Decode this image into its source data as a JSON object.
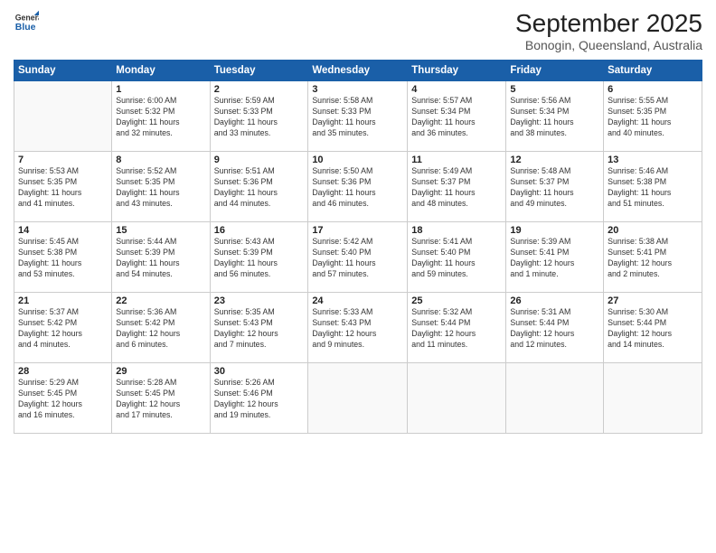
{
  "header": {
    "logo_line1": "General",
    "logo_line2": "Blue",
    "month": "September 2025",
    "location": "Bonogin, Queensland, Australia"
  },
  "days_of_week": [
    "Sunday",
    "Monday",
    "Tuesday",
    "Wednesday",
    "Thursday",
    "Friday",
    "Saturday"
  ],
  "weeks": [
    [
      {
        "num": "",
        "info": ""
      },
      {
        "num": "1",
        "info": "Sunrise: 6:00 AM\nSunset: 5:32 PM\nDaylight: 11 hours\nand 32 minutes."
      },
      {
        "num": "2",
        "info": "Sunrise: 5:59 AM\nSunset: 5:33 PM\nDaylight: 11 hours\nand 33 minutes."
      },
      {
        "num": "3",
        "info": "Sunrise: 5:58 AM\nSunset: 5:33 PM\nDaylight: 11 hours\nand 35 minutes."
      },
      {
        "num": "4",
        "info": "Sunrise: 5:57 AM\nSunset: 5:34 PM\nDaylight: 11 hours\nand 36 minutes."
      },
      {
        "num": "5",
        "info": "Sunrise: 5:56 AM\nSunset: 5:34 PM\nDaylight: 11 hours\nand 38 minutes."
      },
      {
        "num": "6",
        "info": "Sunrise: 5:55 AM\nSunset: 5:35 PM\nDaylight: 11 hours\nand 40 minutes."
      }
    ],
    [
      {
        "num": "7",
        "info": "Sunrise: 5:53 AM\nSunset: 5:35 PM\nDaylight: 11 hours\nand 41 minutes."
      },
      {
        "num": "8",
        "info": "Sunrise: 5:52 AM\nSunset: 5:35 PM\nDaylight: 11 hours\nand 43 minutes."
      },
      {
        "num": "9",
        "info": "Sunrise: 5:51 AM\nSunset: 5:36 PM\nDaylight: 11 hours\nand 44 minutes."
      },
      {
        "num": "10",
        "info": "Sunrise: 5:50 AM\nSunset: 5:36 PM\nDaylight: 11 hours\nand 46 minutes."
      },
      {
        "num": "11",
        "info": "Sunrise: 5:49 AM\nSunset: 5:37 PM\nDaylight: 11 hours\nand 48 minutes."
      },
      {
        "num": "12",
        "info": "Sunrise: 5:48 AM\nSunset: 5:37 PM\nDaylight: 11 hours\nand 49 minutes."
      },
      {
        "num": "13",
        "info": "Sunrise: 5:46 AM\nSunset: 5:38 PM\nDaylight: 11 hours\nand 51 minutes."
      }
    ],
    [
      {
        "num": "14",
        "info": "Sunrise: 5:45 AM\nSunset: 5:38 PM\nDaylight: 11 hours\nand 53 minutes."
      },
      {
        "num": "15",
        "info": "Sunrise: 5:44 AM\nSunset: 5:39 PM\nDaylight: 11 hours\nand 54 minutes."
      },
      {
        "num": "16",
        "info": "Sunrise: 5:43 AM\nSunset: 5:39 PM\nDaylight: 11 hours\nand 56 minutes."
      },
      {
        "num": "17",
        "info": "Sunrise: 5:42 AM\nSunset: 5:40 PM\nDaylight: 11 hours\nand 57 minutes."
      },
      {
        "num": "18",
        "info": "Sunrise: 5:41 AM\nSunset: 5:40 PM\nDaylight: 11 hours\nand 59 minutes."
      },
      {
        "num": "19",
        "info": "Sunrise: 5:39 AM\nSunset: 5:41 PM\nDaylight: 12 hours\nand 1 minute."
      },
      {
        "num": "20",
        "info": "Sunrise: 5:38 AM\nSunset: 5:41 PM\nDaylight: 12 hours\nand 2 minutes."
      }
    ],
    [
      {
        "num": "21",
        "info": "Sunrise: 5:37 AM\nSunset: 5:42 PM\nDaylight: 12 hours\nand 4 minutes."
      },
      {
        "num": "22",
        "info": "Sunrise: 5:36 AM\nSunset: 5:42 PM\nDaylight: 12 hours\nand 6 minutes."
      },
      {
        "num": "23",
        "info": "Sunrise: 5:35 AM\nSunset: 5:43 PM\nDaylight: 12 hours\nand 7 minutes."
      },
      {
        "num": "24",
        "info": "Sunrise: 5:33 AM\nSunset: 5:43 PM\nDaylight: 12 hours\nand 9 minutes."
      },
      {
        "num": "25",
        "info": "Sunrise: 5:32 AM\nSunset: 5:44 PM\nDaylight: 12 hours\nand 11 minutes."
      },
      {
        "num": "26",
        "info": "Sunrise: 5:31 AM\nSunset: 5:44 PM\nDaylight: 12 hours\nand 12 minutes."
      },
      {
        "num": "27",
        "info": "Sunrise: 5:30 AM\nSunset: 5:44 PM\nDaylight: 12 hours\nand 14 minutes."
      }
    ],
    [
      {
        "num": "28",
        "info": "Sunrise: 5:29 AM\nSunset: 5:45 PM\nDaylight: 12 hours\nand 16 minutes."
      },
      {
        "num": "29",
        "info": "Sunrise: 5:28 AM\nSunset: 5:45 PM\nDaylight: 12 hours\nand 17 minutes."
      },
      {
        "num": "30",
        "info": "Sunrise: 5:26 AM\nSunset: 5:46 PM\nDaylight: 12 hours\nand 19 minutes."
      },
      {
        "num": "",
        "info": ""
      },
      {
        "num": "",
        "info": ""
      },
      {
        "num": "",
        "info": ""
      },
      {
        "num": "",
        "info": ""
      }
    ]
  ]
}
